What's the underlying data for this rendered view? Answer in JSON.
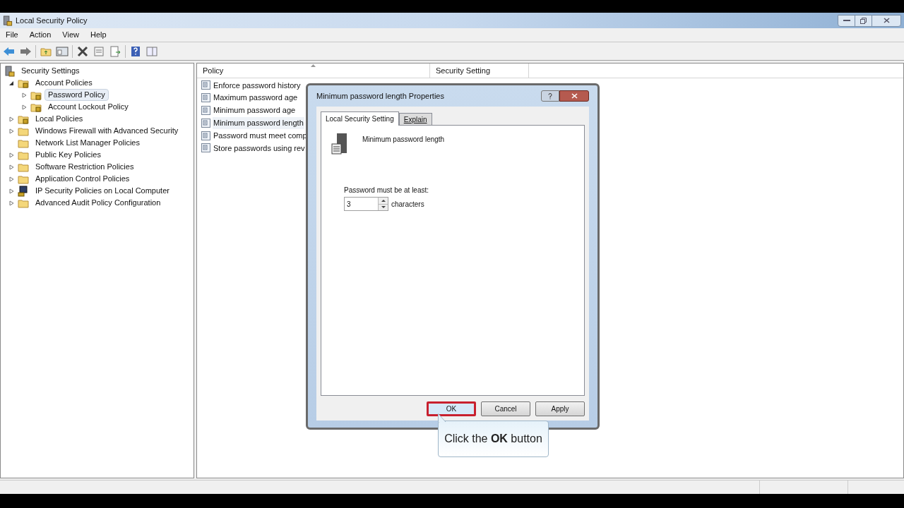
{
  "window": {
    "title": "Local Security Policy"
  },
  "menu": [
    "File",
    "Action",
    "View",
    "Help"
  ],
  "tree": [
    {
      "label": "Security Settings",
      "kind": "root",
      "selected": false,
      "children": [
        {
          "label": "Account Policies",
          "kind": "locked-folder",
          "expanded": true,
          "selected": false,
          "children": [
            {
              "label": "Password Policy",
              "kind": "locked-folder",
              "expanded": false,
              "selected": true
            },
            {
              "label": "Account Lockout Policy",
              "kind": "locked-folder",
              "expanded": false,
              "selected": false
            }
          ]
        },
        {
          "label": "Local Policies",
          "kind": "locked-folder",
          "expanded": false,
          "selected": false
        },
        {
          "label": "Windows Firewall with Advanced Security",
          "kind": "folder",
          "expanded": false,
          "selected": false
        },
        {
          "label": "Network List Manager Policies",
          "kind": "folder",
          "selected": false
        },
        {
          "label": "Public Key Policies",
          "kind": "folder",
          "expanded": false,
          "selected": false
        },
        {
          "label": "Software Restriction Policies",
          "kind": "folder",
          "expanded": false,
          "selected": false
        },
        {
          "label": "Application Control Policies",
          "kind": "folder",
          "expanded": false,
          "selected": false
        },
        {
          "label": "IP Security Policies on Local Computer",
          "kind": "computer",
          "expanded": false,
          "selected": false
        },
        {
          "label": "Advanced Audit Policy Configuration",
          "kind": "folder",
          "expanded": false,
          "selected": false
        }
      ]
    }
  ],
  "table": {
    "columns": [
      "Policy",
      "Security Setting"
    ],
    "rows": [
      {
        "policy": "Enforce password history",
        "selected": false
      },
      {
        "policy": "Maximum password age",
        "selected": false
      },
      {
        "policy": "Minimum password age",
        "selected": false
      },
      {
        "policy": "Minimum password length",
        "selected": true
      },
      {
        "policy": "Password must meet comp",
        "selected": false
      },
      {
        "policy": "Store passwords using rev",
        "selected": false
      }
    ]
  },
  "dialog": {
    "title": "Minimum password length Properties",
    "tabs": [
      {
        "label": "Local Security Setting",
        "selected": true
      },
      {
        "label": "Explain",
        "selected": false
      }
    ],
    "heading": "Minimum password length",
    "field_label": "Password must be at least:",
    "field_value": "3",
    "unit": "characters",
    "buttons": [
      {
        "label": "OK",
        "highlighted": true
      },
      {
        "label": "Cancel",
        "highlighted": false
      },
      {
        "label": "Apply",
        "highlighted": false
      }
    ]
  },
  "callout": "Click the **OK** button"
}
